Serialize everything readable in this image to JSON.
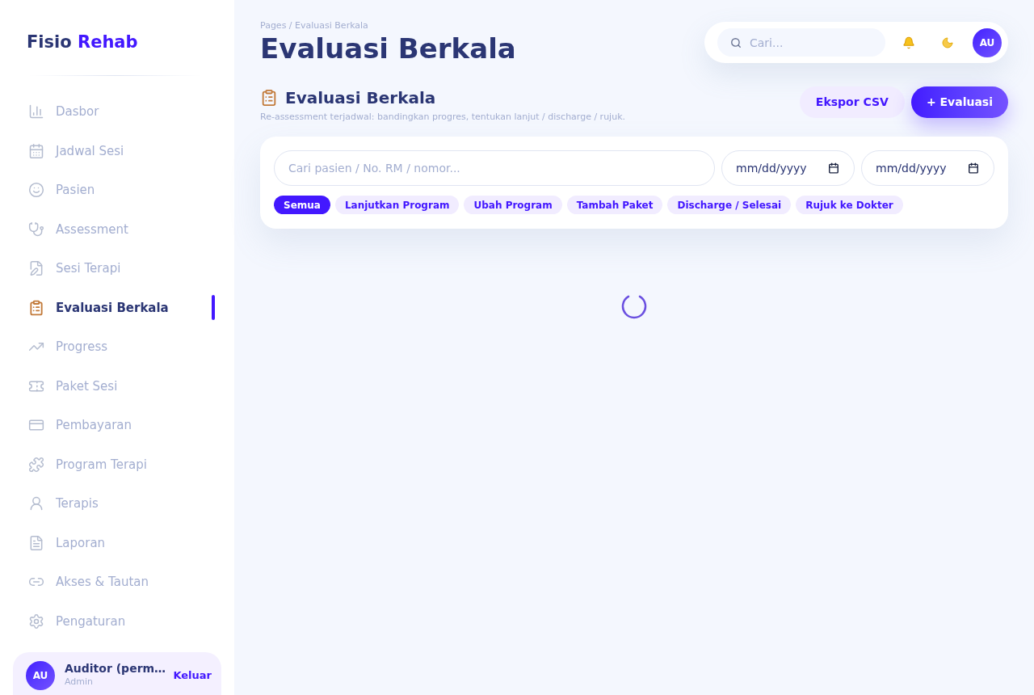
{
  "sidebar": {
    "brand": {
      "name": "Fisio",
      "accent": "Rehab"
    },
    "items": [
      {
        "label": "Dasbor",
        "selected": false
      },
      {
        "label": "Jadwal Sesi",
        "selected": false
      },
      {
        "label": "Pasien",
        "selected": false
      },
      {
        "label": "Assessment",
        "selected": false
      },
      {
        "label": "Sesi Terapi",
        "selected": false
      },
      {
        "label": "Evaluasi Berkala",
        "selected": true
      },
      {
        "label": "Progress",
        "selected": false
      },
      {
        "label": "Paket Sesi",
        "selected": false
      },
      {
        "label": "Pembayaran",
        "selected": false
      },
      {
        "label": "Program Terapi",
        "selected": false
      },
      {
        "label": "Terapis",
        "selected": false
      },
      {
        "label": "Laporan",
        "selected": false
      },
      {
        "label": "Akses & Tautan",
        "selected": false
      },
      {
        "label": "Pengaturan",
        "selected": false
      }
    ],
    "user": {
      "initials": "AU",
      "name": "Auditor (perm…",
      "role": "Admin",
      "logout": "Keluar"
    }
  },
  "header": {
    "breadcrumb": "Pages / Evaluasi Berkala",
    "title": "Evaluasi Berkala",
    "search": {
      "placeholder": "Cari..."
    },
    "avatar": "AU"
  },
  "section": {
    "title": "Evaluasi Berkala",
    "subtitle": "Re-assessment terjadwal: bandingkan progres, tentukan lanjut / discharge / rujuk.",
    "buttons": [
      {
        "label": "Ekspor CSV",
        "kind": "secondary"
      },
      {
        "label": "+ Evaluasi",
        "kind": "primary"
      }
    ]
  },
  "filters": {
    "search": {
      "placeholder": "Cari pasien / No. RM / nomor..."
    },
    "date_from": {
      "placeholder": "mm/dd/yyyy"
    },
    "date_to": {
      "placeholder": "mm/dd/yyyy"
    },
    "chips": [
      {
        "label": "Semua",
        "selected": true
      },
      {
        "label": "Lanjutkan Program",
        "selected": false
      },
      {
        "label": "Ubah Program",
        "selected": false
      },
      {
        "label": "Tambah Paket",
        "selected": false
      },
      {
        "label": "Discharge / Selesai",
        "selected": false
      },
      {
        "label": "Rujuk ke Dokter",
        "selected": false
      }
    ]
  },
  "content": {
    "loading": true
  }
}
